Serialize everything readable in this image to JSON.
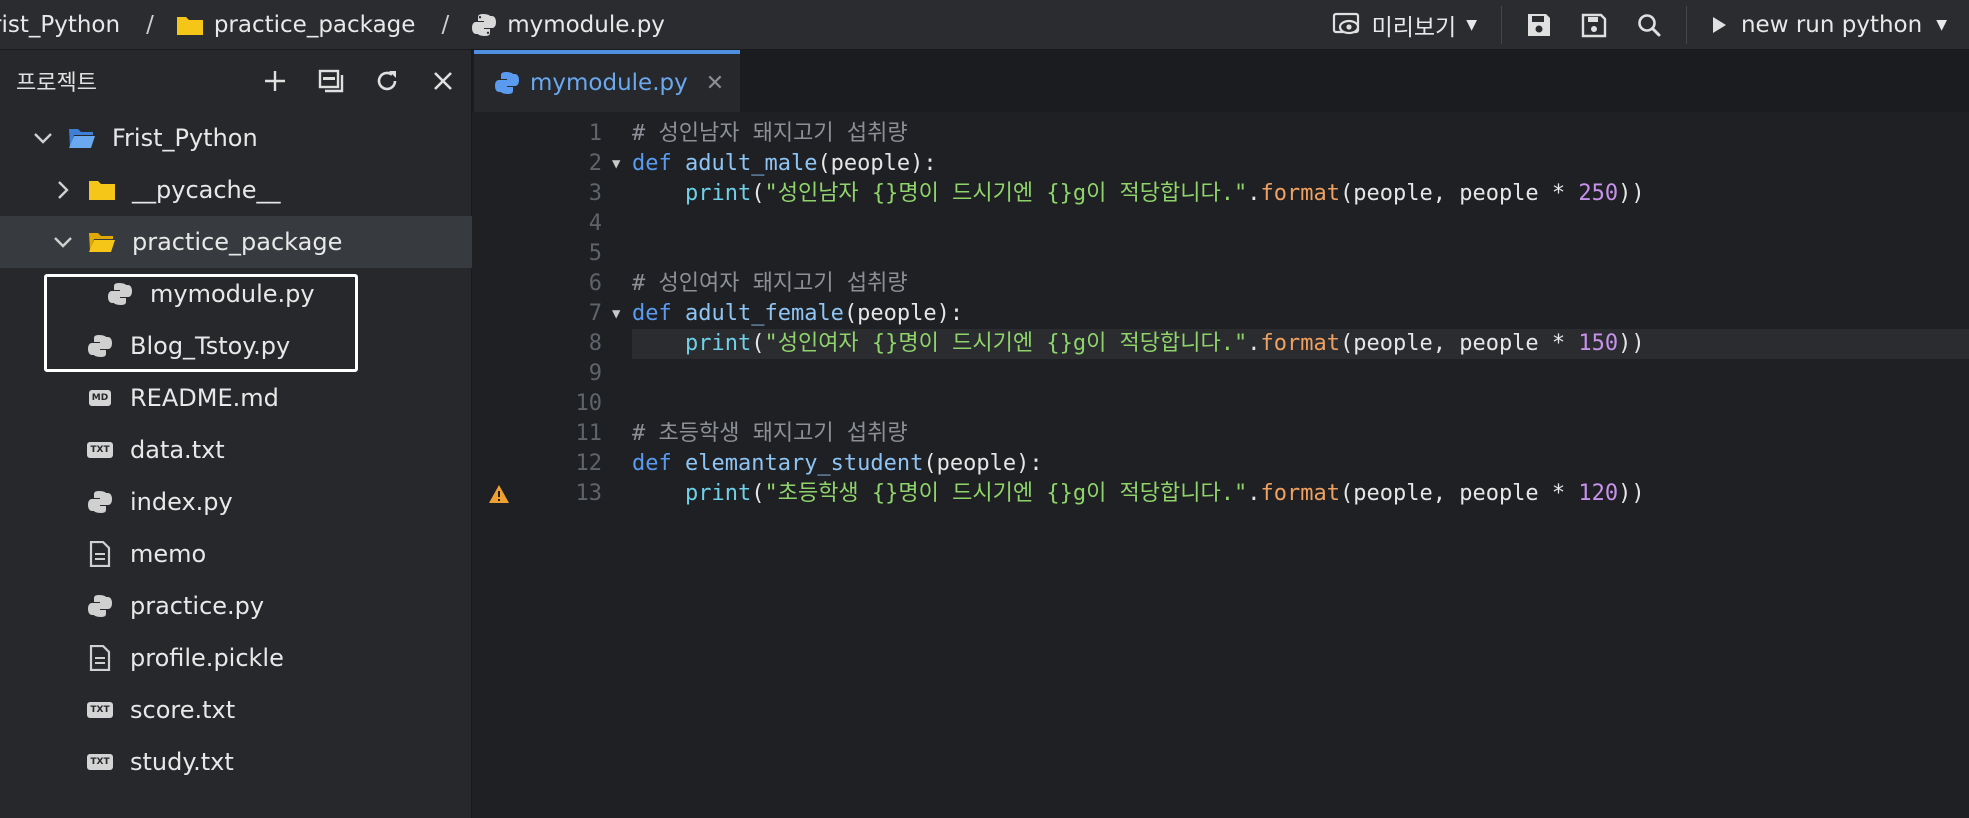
{
  "breadcrumb": {
    "items": [
      "rist_Python",
      "practice_package",
      "mymodule.py"
    ],
    "separator": "/"
  },
  "toolbar": {
    "preview_label": "미리보기",
    "run_label": "new run python"
  },
  "sidebar": {
    "title": "프로젝트",
    "tree": [
      {
        "label": "Frist_Python",
        "type": "folder-open",
        "icon": "folder-open-icon"
      },
      {
        "label": "__pycache__",
        "type": "folder",
        "icon": "folder-icon"
      },
      {
        "label": "practice_package",
        "type": "folder-open",
        "icon": "folder-open-icon"
      },
      {
        "label": "mymodule.py",
        "type": "python",
        "icon": "python-file-icon"
      },
      {
        "label": "Blog_Tstoy.py",
        "type": "python",
        "icon": "python-file-icon"
      },
      {
        "label": "README.md",
        "type": "md",
        "icon": "markdown-file-icon",
        "badge": "MD"
      },
      {
        "label": "data.txt",
        "type": "txt",
        "icon": "text-file-icon",
        "badge": "TXT"
      },
      {
        "label": "index.py",
        "type": "python",
        "icon": "python-file-icon"
      },
      {
        "label": "memo",
        "type": "doc",
        "icon": "document-icon"
      },
      {
        "label": "practice.py",
        "type": "python",
        "icon": "python-file-icon"
      },
      {
        "label": "profile.pickle",
        "type": "doc",
        "icon": "document-icon"
      },
      {
        "label": "score.txt",
        "type": "txt",
        "icon": "text-file-icon",
        "badge": "TXT"
      },
      {
        "label": "study.txt",
        "type": "txt",
        "icon": "text-file-icon",
        "badge": "TXT"
      }
    ]
  },
  "editor": {
    "tab_label": "mymodule.py",
    "current_line": 8,
    "lines": [
      {
        "num": "1",
        "tokens": [
          [
            "c-comment",
            "# 성인남자 돼지고기 섭취량"
          ]
        ]
      },
      {
        "num": "2",
        "fold": "▼",
        "tokens": [
          [
            "c-kw",
            "def "
          ],
          [
            "c-fn",
            "adult_male"
          ],
          [
            "c-plain",
            "(people):"
          ]
        ]
      },
      {
        "num": "3",
        "tokens": [
          [
            "c-plain",
            "    "
          ],
          [
            "c-builtin",
            "print"
          ],
          [
            "c-plain",
            "("
          ],
          [
            "c-str",
            "\"성인남자 {}명이 드시기엔 {}g이 적당합니다.\""
          ],
          [
            "c-plain",
            "."
          ],
          [
            "c-method",
            "format"
          ],
          [
            "c-plain",
            "(people, people * "
          ],
          [
            "c-num",
            "250"
          ],
          [
            "c-plain",
            "))"
          ]
        ]
      },
      {
        "num": "4",
        "tokens": []
      },
      {
        "num": "5",
        "tokens": []
      },
      {
        "num": "6",
        "tokens": [
          [
            "c-comment",
            "# 성인여자 돼지고기 섭취량"
          ]
        ]
      },
      {
        "num": "7",
        "fold": "▼",
        "tokens": [
          [
            "c-kw",
            "def "
          ],
          [
            "c-fn",
            "adult_female"
          ],
          [
            "c-plain",
            "(people):"
          ]
        ]
      },
      {
        "num": "8",
        "tokens": [
          [
            "c-plain",
            "    "
          ],
          [
            "c-builtin",
            "print"
          ],
          [
            "c-plain",
            "("
          ],
          [
            "c-str",
            "\"성인여자 {}명이 드시기엔 {}g이 적당합니다.\""
          ],
          [
            "c-plain",
            "."
          ],
          [
            "c-method",
            "format"
          ],
          [
            "c-plain",
            "(people, people * "
          ],
          [
            "c-num",
            "150"
          ],
          [
            "c-plain",
            "))"
          ]
        ]
      },
      {
        "num": "9",
        "tokens": []
      },
      {
        "num": "10",
        "tokens": []
      },
      {
        "num": "11",
        "tokens": [
          [
            "c-comment",
            "# 초등학생 돼지고기 섭취량"
          ]
        ]
      },
      {
        "num": "12",
        "tokens": [
          [
            "c-kw",
            "def "
          ],
          [
            "c-fn",
            "elemantary_student"
          ],
          [
            "c-plain",
            "(people):"
          ]
        ]
      },
      {
        "num": "13",
        "warning": true,
        "tokens": [
          [
            "c-plain",
            "    "
          ],
          [
            "c-builtin",
            "print"
          ],
          [
            "c-plain",
            "("
          ],
          [
            "c-str",
            "\"초등학생 {}명이 드시기엔 {}g이 적당합니다.\""
          ],
          [
            "c-plain",
            "."
          ],
          [
            "c-method",
            "format"
          ],
          [
            "c-plain",
            "(people, people * "
          ],
          [
            "c-num",
            "120"
          ],
          [
            "c-plain",
            "))"
          ]
        ]
      }
    ]
  },
  "colors": {
    "accent": "#4f8fe0",
    "folder": "#f5c518",
    "folder_root": "#4f8fe0"
  }
}
